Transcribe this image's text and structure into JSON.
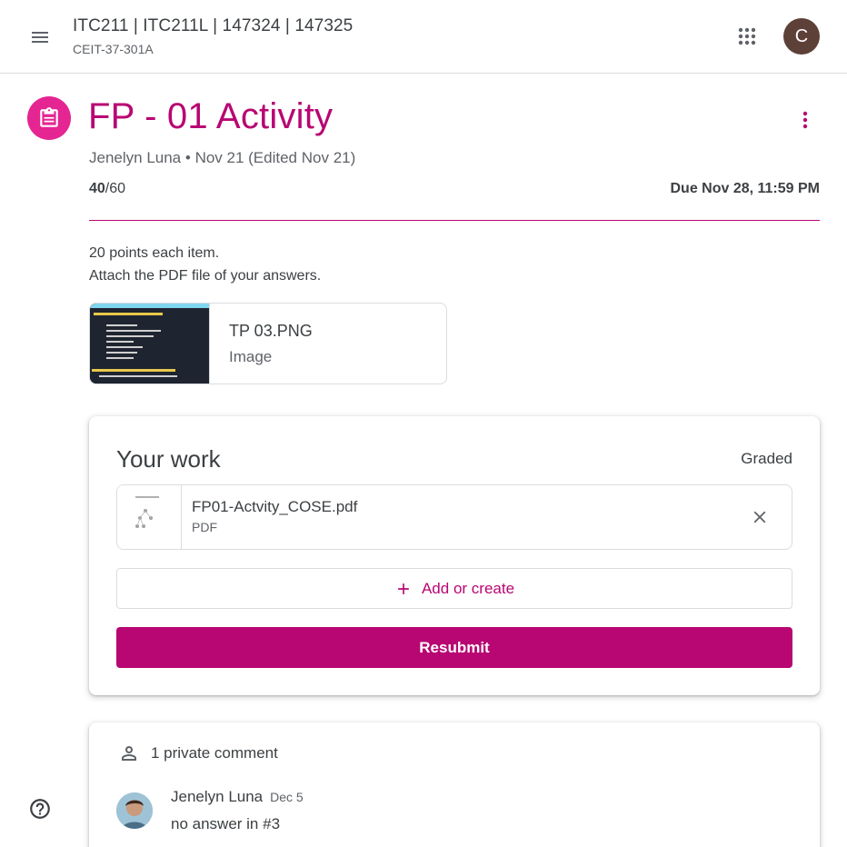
{
  "header": {
    "course_title": "ITC211 | ITC211L | 147324 | 147325",
    "course_section": "CEIT-37-301A",
    "avatar_letter": "C",
    "menu_icon": "hamburger-menu-icon",
    "apps_icon": "apps-grid-icon"
  },
  "assignment": {
    "title": "FP - 01 Activity",
    "author": "Jenelyn Luna",
    "posted": "Nov 21 (Edited Nov 21)",
    "meta_separator": "•",
    "points_earned": "40",
    "points_total": "/60",
    "due": "Due Nov 28, 11:59 PM",
    "instructions_line1": "20 points each item.",
    "instructions_line2": "Attach the PDF file of your answers.",
    "accent_color": "#b80672"
  },
  "attachment": {
    "name": "TP 03.PNG",
    "type": "Image"
  },
  "your_work": {
    "title": "Your work",
    "status": "Graded",
    "file_name": "FP01-Actvity_COSE.pdf",
    "file_type": "PDF",
    "add_label": "Add or create",
    "resubmit_label": "Resubmit"
  },
  "comments": {
    "header": "1 private comment",
    "items": [
      {
        "author": "Jenelyn Luna",
        "date": "Dec 5",
        "text": "no answer in #3"
      }
    ]
  }
}
